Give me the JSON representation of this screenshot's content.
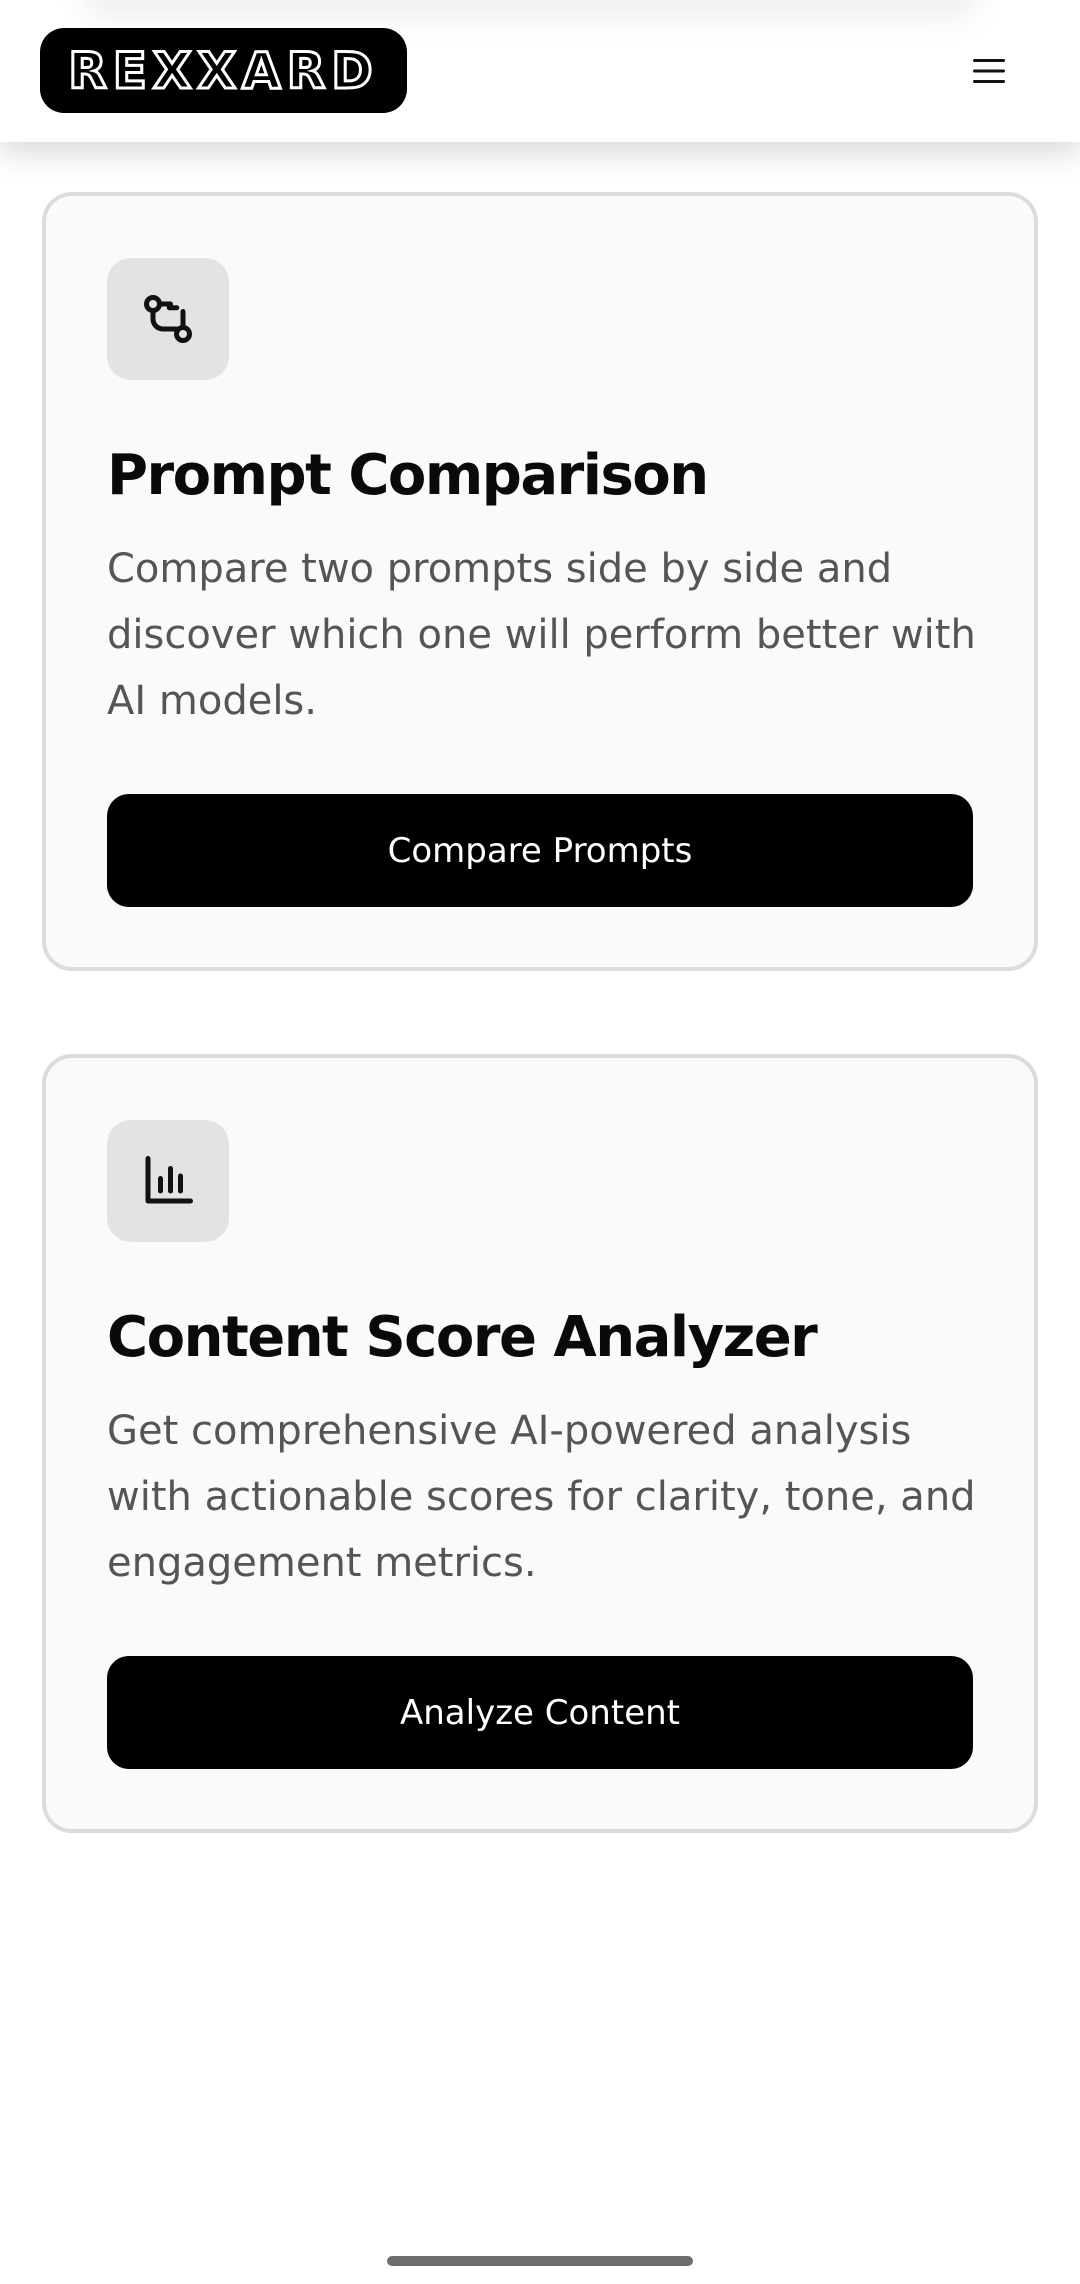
{
  "header": {
    "logo_text": "REXXARD",
    "menu_icon": "hamburger-icon"
  },
  "cards": [
    {
      "icon": "git-compare-icon",
      "title": "Prompt Comparison",
      "description": "Compare two prompts side by side and discover which one will perform better with AI models.",
      "button_label": "Compare Prompts"
    },
    {
      "icon": "bar-chart-icon",
      "title": "Content Score Analyzer",
      "description": "Get comprehensive AI-powered analysis with actionable scores for clarity, tone, and engagement metrics.",
      "button_label": "Analyze Content"
    }
  ],
  "colors": {
    "primary": "#000000",
    "card_background": "#fafafa",
    "card_border": "#dcdcdc",
    "icon_background": "#e3e3e3",
    "description_text": "#555555"
  }
}
